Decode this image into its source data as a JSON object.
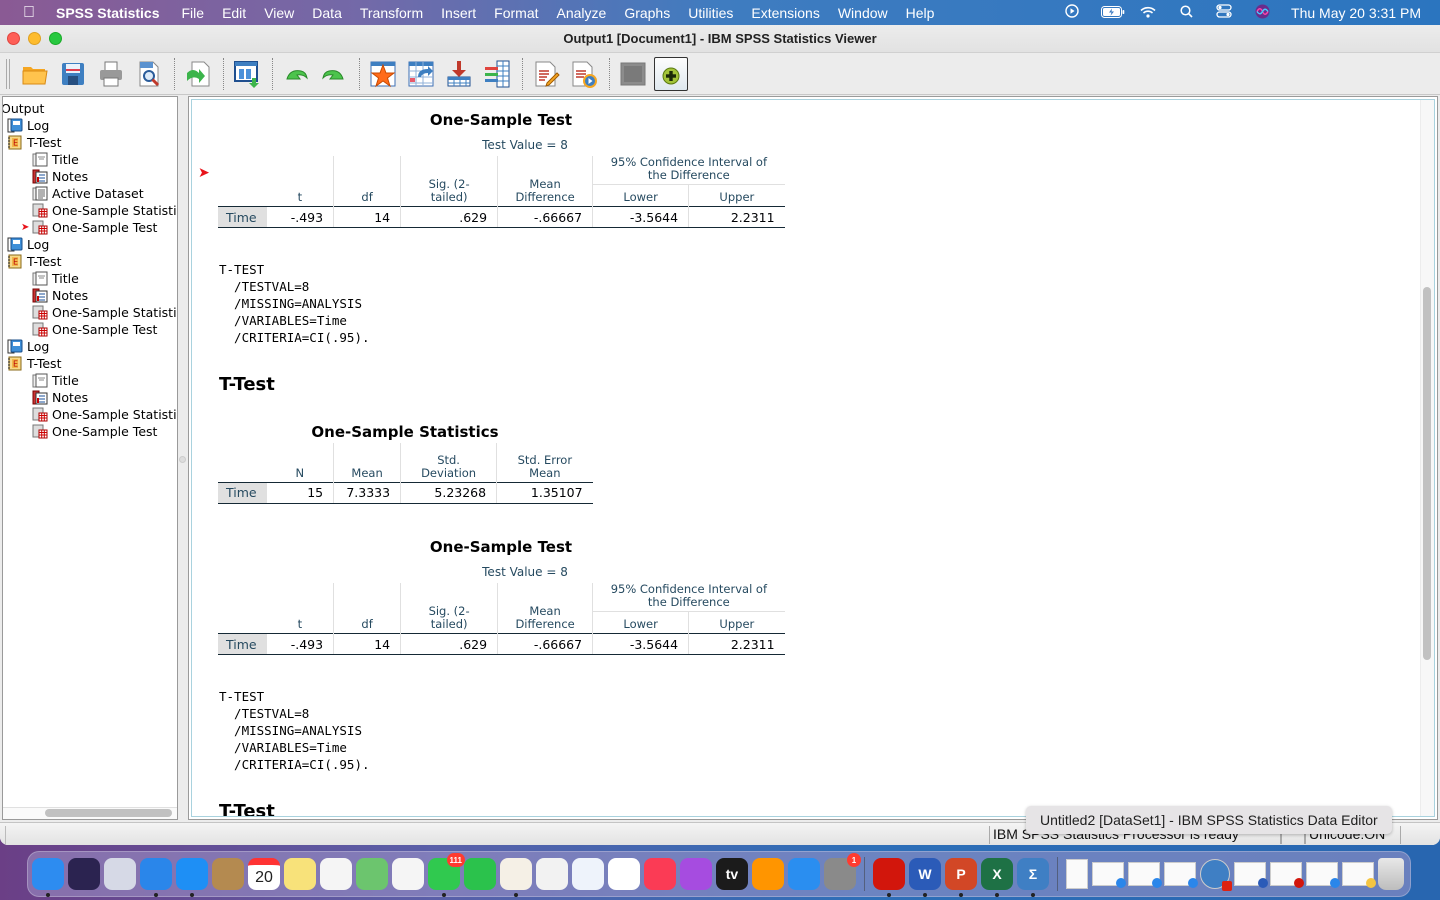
{
  "menubar": {
    "app_name": "SPSS Statistics",
    "items": [
      "File",
      "Edit",
      "View",
      "Data",
      "Transform",
      "Insert",
      "Format",
      "Analyze",
      "Graphs",
      "Utilities",
      "Extensions",
      "Window",
      "Help"
    ],
    "status_icons": [
      "play-circle-icon",
      "battery-charging-icon",
      "wifi-icon",
      "spotlight-search-icon",
      "control-center-icon",
      "siri-icon"
    ],
    "clock": "Thu May 20  3:31 PM"
  },
  "window": {
    "title": "Output1 [Document1] - IBM SPSS Statistics Viewer"
  },
  "toolbar": {
    "buttons": [
      {
        "name": "open",
        "icon": "folder-open-icon"
      },
      {
        "name": "save",
        "icon": "floppy-disk-icon"
      },
      {
        "name": "print",
        "icon": "printer-icon"
      },
      {
        "name": "print-preview",
        "icon": "magnifier-document-icon"
      },
      {
        "name": "export",
        "icon": "export-document-icon"
      },
      {
        "name": "recall-dialog",
        "icon": "dialog-recall-icon"
      },
      {
        "name": "undo",
        "icon": "undo-arrow-icon"
      },
      {
        "name": "redo",
        "icon": "redo-arrow-icon"
      },
      {
        "name": "goto-data",
        "icon": "star-data-icon"
      },
      {
        "name": "goto-case",
        "icon": "goto-case-icon"
      },
      {
        "name": "goto-variable",
        "icon": "goto-variable-icon"
      },
      {
        "name": "variables",
        "icon": "variables-icon"
      },
      {
        "name": "insert-text",
        "icon": "edit-document-icon"
      },
      {
        "name": "run-script",
        "icon": "run-document-icon"
      },
      {
        "name": "designate-window-disabled",
        "icon": "disabled-square-icon"
      },
      {
        "name": "designate-window",
        "icon": "add-circle-icon"
      }
    ]
  },
  "outline": {
    "items": [
      {
        "label": "Output",
        "level": 0,
        "icon": "none"
      },
      {
        "label": "Log",
        "level": 1,
        "icon": "log-book-icon"
      },
      {
        "label": "T-Test",
        "level": 1,
        "icon": "procedure-book-icon"
      },
      {
        "label": "Title",
        "level": 2,
        "icon": "title-icon"
      },
      {
        "label": "Notes",
        "level": 2,
        "icon": "notes-icon"
      },
      {
        "label": "Active Dataset",
        "level": 2,
        "icon": "text-page-icon"
      },
      {
        "label": "One-Sample Statistics",
        "level": 2,
        "icon": "table-icon"
      },
      {
        "label": "One-Sample Test",
        "level": 2,
        "icon": "table-icon",
        "current": true
      },
      {
        "label": "Log",
        "level": 1,
        "icon": "log-book-icon"
      },
      {
        "label": "T-Test",
        "level": 1,
        "icon": "procedure-book-icon"
      },
      {
        "label": "Title",
        "level": 2,
        "icon": "title-icon"
      },
      {
        "label": "Notes",
        "level": 2,
        "icon": "notes-icon"
      },
      {
        "label": "One-Sample Statistics",
        "level": 2,
        "icon": "table-icon"
      },
      {
        "label": "One-Sample Test",
        "level": 2,
        "icon": "table-icon"
      },
      {
        "label": "Log",
        "level": 1,
        "icon": "log-book-icon"
      },
      {
        "label": "T-Test",
        "level": 1,
        "icon": "procedure-book-icon"
      },
      {
        "label": "Title",
        "level": 2,
        "icon": "title-icon"
      },
      {
        "label": "Notes",
        "level": 2,
        "icon": "notes-icon"
      },
      {
        "label": "One-Sample Statistics",
        "level": 2,
        "icon": "table-icon"
      },
      {
        "label": "One-Sample Test",
        "level": 2,
        "icon": "table-icon"
      }
    ]
  },
  "content": {
    "test_table_1": {
      "title": "One-Sample Test",
      "test_value": "Test Value = 8",
      "headers": {
        "t": "t",
        "df": "df",
        "sig": "Sig. (2-\ntailed)",
        "mean_diff": "Mean\nDifference",
        "ci": "95% Confidence Interval of\nthe Difference",
        "lower": "Lower",
        "upper": "Upper"
      },
      "row": {
        "label": "Time",
        "t": "-.493",
        "df": "14",
        "sig": ".629",
        "mean_diff": "-.66667",
        "lower": "-3.5644",
        "upper": "2.2311"
      }
    },
    "syntax_1": "T-TEST\n  /TESTVAL=8\n  /MISSING=ANALYSIS\n  /VARIABLES=Time\n  /CRITERIA=CI(.95).",
    "heading_1": "T-Test",
    "stats_table": {
      "title": "One-Sample Statistics",
      "headers": {
        "n": "N",
        "mean": "Mean",
        "sd": "Std.\nDeviation",
        "se": "Std. Error\nMean"
      },
      "row": {
        "label": "Time",
        "n": "15",
        "mean": "7.3333",
        "sd": "5.23268",
        "se": "1.35107"
      }
    },
    "test_table_2": {
      "title": "One-Sample Test",
      "test_value": "Test Value = 8",
      "headers": {
        "t": "t",
        "df": "df",
        "sig": "Sig. (2-\ntailed)",
        "mean_diff": "Mean\nDifference",
        "ci": "95% Confidence Interval of\nthe Difference",
        "lower": "Lower",
        "upper": "Upper"
      },
      "row": {
        "label": "Time",
        "t": "-.493",
        "df": "14",
        "sig": ".629",
        "mean_diff": "-.66667",
        "lower": "-3.5644",
        "upper": "2.2311"
      }
    },
    "syntax_2": "T-TEST\n  /TESTVAL=8\n  /MISSING=ANALYSIS\n  /VARIABLES=Time\n  /CRITERIA=CI(.95).",
    "heading_2": "T-Test"
  },
  "statusbar": {
    "processor_status": "IBM SPSS Statistics Processor is ready",
    "unicode": "Unicode:ON"
  },
  "tooltip": "Untitled2 [DataSet1] - IBM SPSS Statistics Data Editor",
  "dock": {
    "apps": [
      {
        "name": "finder",
        "icon": "finder-icon",
        "color": "#2d8cf0",
        "running": true
      },
      {
        "name": "siri",
        "icon": "siri-icon",
        "color": "#2b2350"
      },
      {
        "name": "launchpad",
        "icon": "launchpad-icon",
        "color": "#d6d9e6"
      },
      {
        "name": "safari",
        "icon": "safari-icon",
        "color": "#2a86ea",
        "running": true
      },
      {
        "name": "mail",
        "icon": "mail-icon",
        "color": "#1e8ff5",
        "running": true
      },
      {
        "name": "contacts",
        "icon": "contacts-icon",
        "color": "#b48a50"
      },
      {
        "name": "calendar",
        "icon": "calendar-icon",
        "color": "#ffffff",
        "text": "20"
      },
      {
        "name": "notes",
        "icon": "notes-app-icon",
        "color": "#f8e27a"
      },
      {
        "name": "reminders",
        "icon": "reminders-icon",
        "color": "#f5f5f5"
      },
      {
        "name": "maps",
        "icon": "maps-icon",
        "color": "#6cc56e"
      },
      {
        "name": "photos",
        "icon": "photos-icon",
        "color": "#f5f5f5"
      },
      {
        "name": "messages",
        "icon": "messages-icon",
        "color": "#30c94f",
        "badge": "111",
        "running": true
      },
      {
        "name": "facetime",
        "icon": "facetime-icon",
        "color": "#2bc24c"
      },
      {
        "name": "textedit",
        "icon": "textedit-icon",
        "color": "#f5f0e6",
        "running": true
      },
      {
        "name": "numbers",
        "icon": "numbers-icon",
        "color": "#f2f2f2"
      },
      {
        "name": "keynote",
        "icon": "keynote-icon",
        "color": "#eef3fb"
      },
      {
        "name": "news",
        "icon": "news-icon",
        "color": "#ffffff"
      },
      {
        "name": "music",
        "icon": "music-icon",
        "color": "#fb3b55"
      },
      {
        "name": "podcasts",
        "icon": "podcasts-icon",
        "color": "#a64ce0"
      },
      {
        "name": "apple-tv",
        "icon": "tv-icon",
        "color": "#1b1b1b",
        "text": "tv"
      },
      {
        "name": "books",
        "icon": "books-icon",
        "color": "#ff9500"
      },
      {
        "name": "app-store",
        "icon": "app-store-icon",
        "color": "#2a8ef0"
      },
      {
        "name": "system-preferences",
        "icon": "gear-icon",
        "color": "#8a8a8a",
        "badge": "1"
      }
    ],
    "apps2": [
      {
        "name": "acrobat",
        "icon": "acrobat-icon",
        "color": "#d2160c",
        "running": true
      },
      {
        "name": "word",
        "icon": "word-icon",
        "color": "#2b5bb8",
        "text": "W",
        "running": true
      },
      {
        "name": "powerpoint",
        "icon": "powerpoint-icon",
        "color": "#d24726",
        "text": "P",
        "running": true
      },
      {
        "name": "excel",
        "icon": "excel-icon",
        "color": "#1e7145",
        "text": "X",
        "running": true
      },
      {
        "name": "spss",
        "icon": "spss-sigma-icon",
        "color": "#3f7fc4",
        "text": "Σ",
        "running": true
      }
    ],
    "documents": [
      {
        "name": "document-1",
        "icon": "document-icon"
      },
      {
        "name": "window-safari-1",
        "icon": "safari-window-icon"
      },
      {
        "name": "window-safari-2",
        "icon": "safari-window-icon"
      },
      {
        "name": "window-safari-3",
        "icon": "safari-window-icon"
      },
      {
        "name": "window-spss-data",
        "icon": "spss-data-editor-icon"
      },
      {
        "name": "window-word",
        "icon": "word-window-icon"
      },
      {
        "name": "window-acrobat",
        "icon": "acrobat-window-icon"
      },
      {
        "name": "window-safari-4",
        "icon": "safari-window-icon"
      },
      {
        "name": "window-textedit",
        "icon": "textedit-window-icon"
      }
    ],
    "trash": {
      "name": "trash",
      "icon": "trash-icon"
    }
  }
}
